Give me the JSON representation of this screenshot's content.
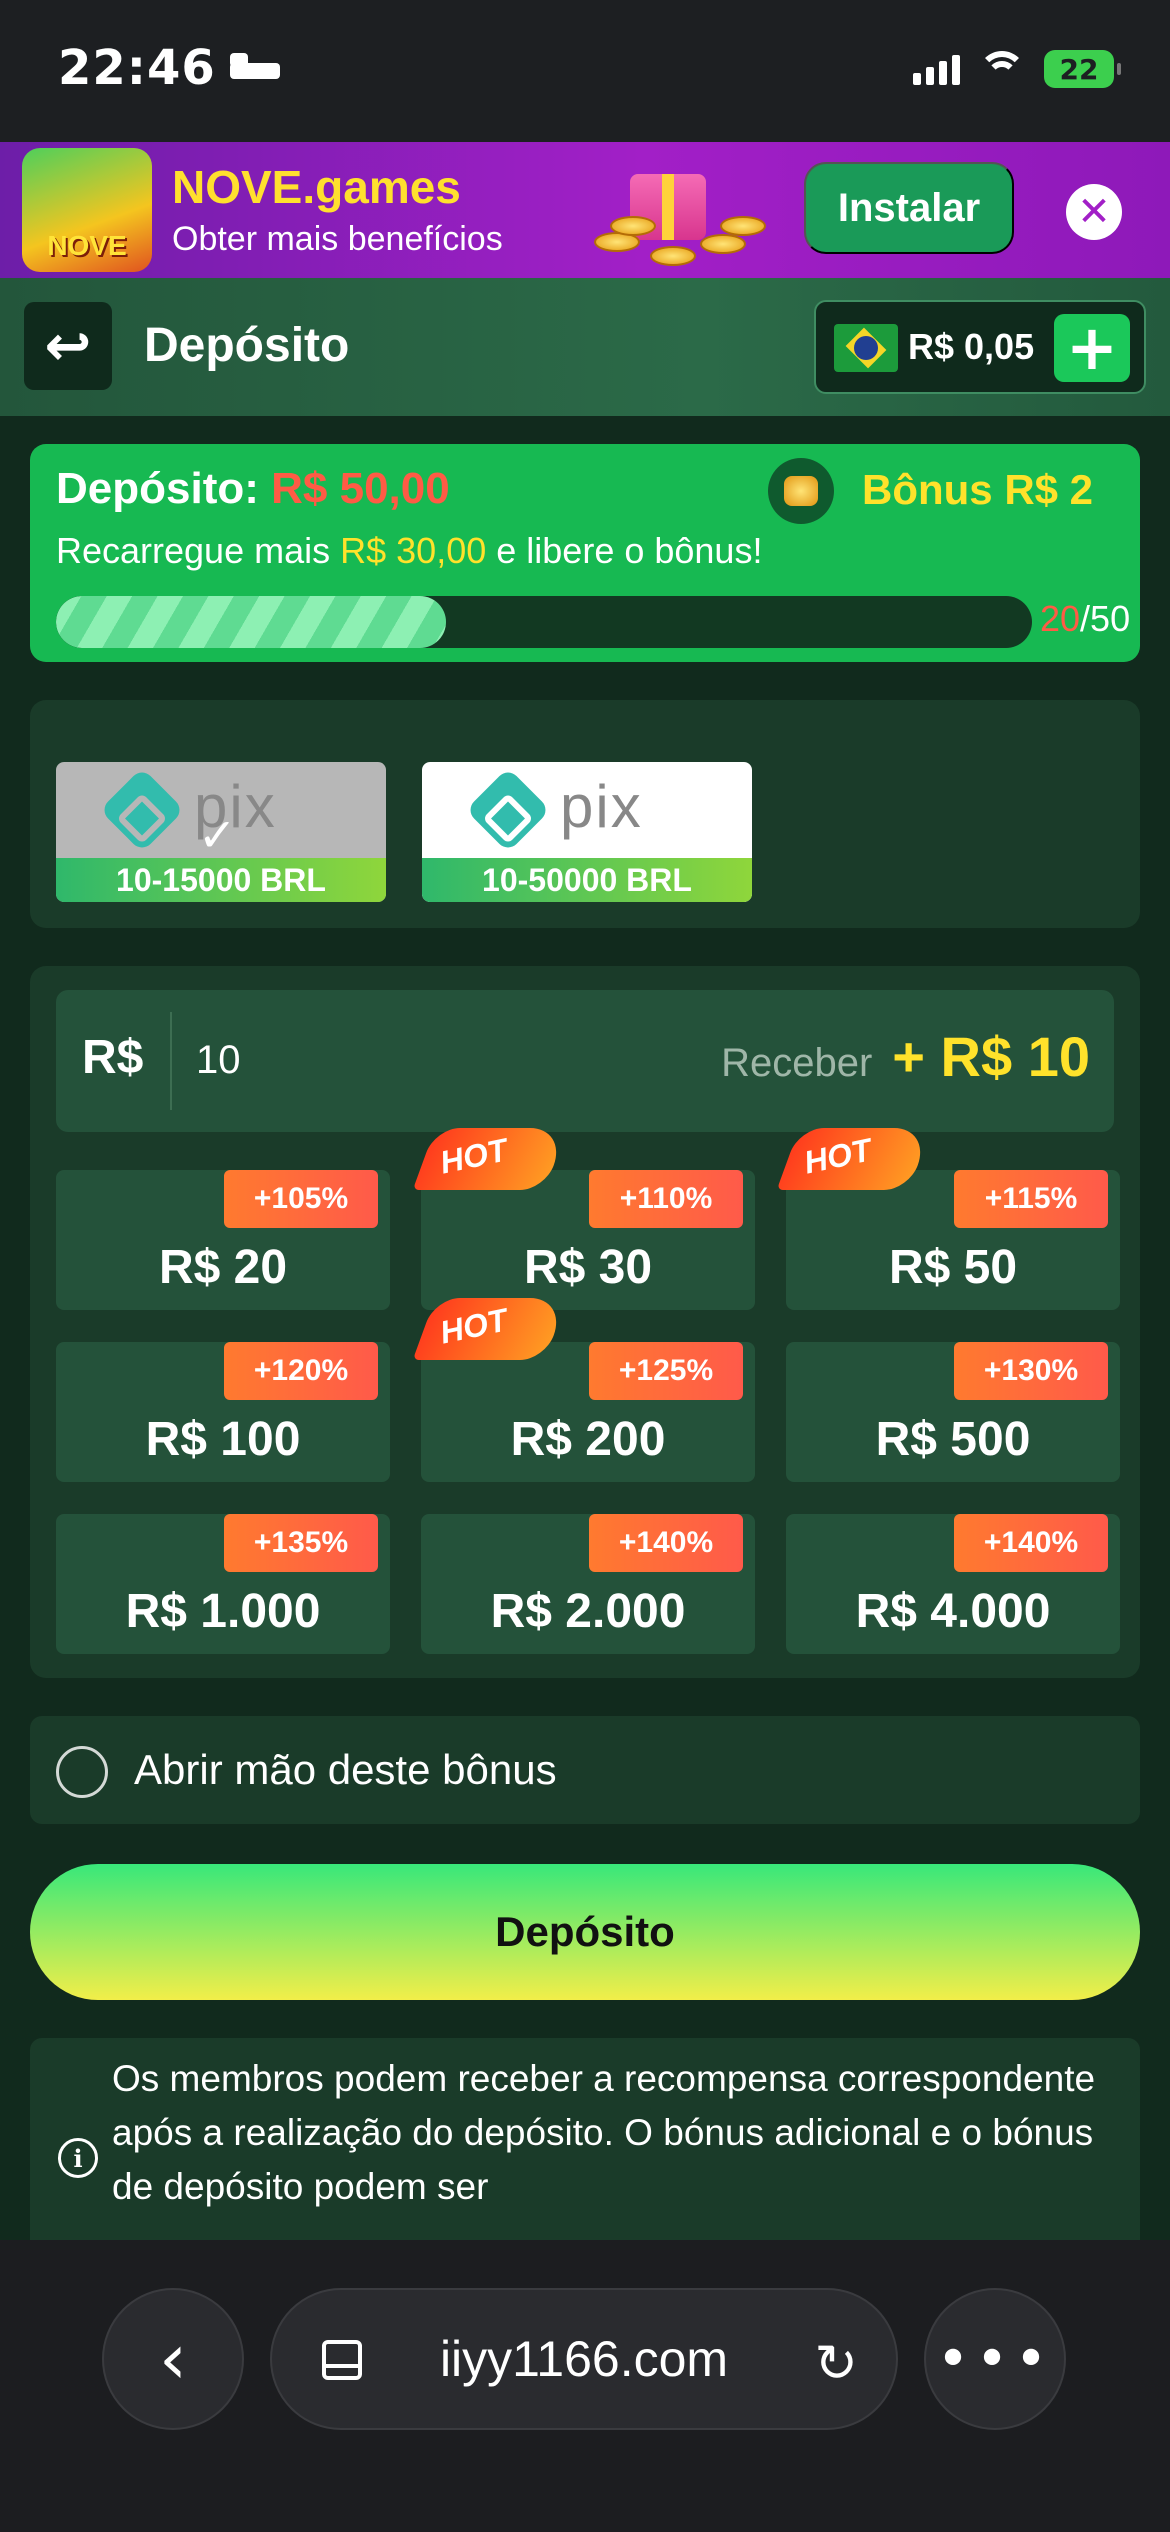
{
  "status_bar": {
    "time": "22:46",
    "battery": "22"
  },
  "promo": {
    "app_name": "NOVE.games",
    "subtitle": "Obter mais benefícios",
    "logo_text": "NOVE",
    "install_label": "Instalar",
    "close_icon": "close-icon"
  },
  "header": {
    "back_icon": "back-arrow-icon",
    "title": "Depósito",
    "balance": "R$ 0,05",
    "add_icon": "plus-icon"
  },
  "bonus": {
    "deposit_label": "Depósito:",
    "deposit_amount": "R$ 50,00",
    "bonus_label": "Bônus R$ 2",
    "desc_prefix": "Recarregue mais",
    "desc_amount": "R$ 30,00",
    "desc_suffix": "e libere o bônus!",
    "progress_current": "20",
    "progress_total": "/50",
    "progress_fraction": 0.4
  },
  "methods": [
    {
      "name": "pix",
      "range": "10-15000 BRL",
      "selected": true
    },
    {
      "name": "pix",
      "range": "10-50000 BRL",
      "selected": false
    }
  ],
  "amount_input": {
    "currency": "R$",
    "value": "10",
    "receive_label": "Receber",
    "receive_value": "+ R$ 10"
  },
  "hot_label": "HOT",
  "tiles": [
    {
      "amount": "R$ 20",
      "bonus": "+105%",
      "hot": false
    },
    {
      "amount": "R$ 30",
      "bonus": "+110%",
      "hot": true
    },
    {
      "amount": "R$ 50",
      "bonus": "+115%",
      "hot": true
    },
    {
      "amount": "R$ 100",
      "bonus": "+120%",
      "hot": false
    },
    {
      "amount": "R$ 200",
      "bonus": "+125%",
      "hot": true
    },
    {
      "amount": "R$ 500",
      "bonus": "+130%",
      "hot": false
    },
    {
      "amount": "R$ 1.000",
      "bonus": "+135%",
      "hot": false
    },
    {
      "amount": "R$ 2.000",
      "bonus": "+140%",
      "hot": false
    },
    {
      "amount": "R$ 4.000",
      "bonus": "+140%",
      "hot": false
    }
  ],
  "waive_label": "Abrir mão deste bônus",
  "deposit_button": "Depósito",
  "info_text": "Os membros podem receber a recompensa correspondente após a realização do depósito. O bónus adicional e o bónus de depósito podem ser",
  "browser": {
    "url": "iiyy1166.com"
  },
  "colors": {
    "accent_green": "#17b952",
    "highlight_yellow": "#ffe22b",
    "alert_red": "#ff5b45",
    "panel": "#1a3b29"
  }
}
